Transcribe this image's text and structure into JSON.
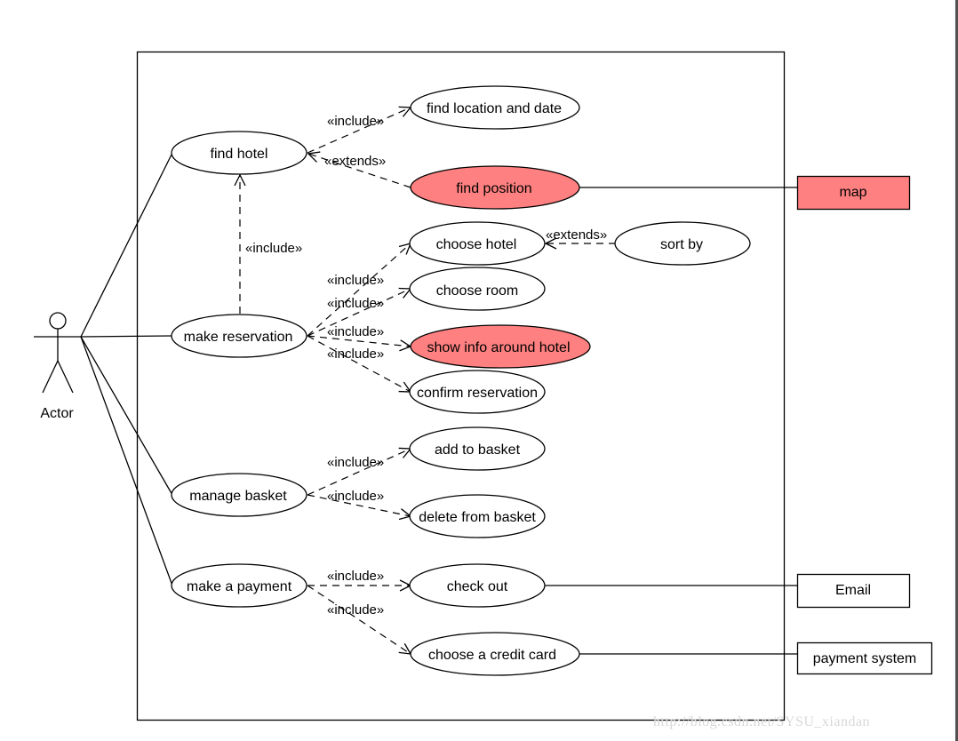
{
  "colors": {
    "highlight_fill": "#FF8080",
    "default_fill": "#FFFFFF",
    "stroke": "#000000"
  },
  "actor": {
    "label": "Actor"
  },
  "use_cases": {
    "find_hotel": "find hotel",
    "find_location_and_date": "find location and date",
    "find_position": "find position",
    "make_reservation": "make reservation",
    "choose_hotel": "choose hotel",
    "sort_by": "sort by",
    "choose_room": "choose room",
    "show_info_around_hotel": "show info around hotel",
    "confirm_reservation": "confirm reservation",
    "manage_basket": "manage basket",
    "add_to_basket": "add to basket",
    "delete_from_basket": "delete from basket",
    "make_a_payment": "make a payment",
    "check_out": "check out",
    "choose_a_credit_card": "choose a credit card"
  },
  "highlighted_use_cases": [
    "find_position",
    "show_info_around_hotel"
  ],
  "external_systems": {
    "map": "map",
    "email": "Email",
    "payment_system": "payment system"
  },
  "relations": [
    {
      "from": "find_hotel",
      "to": "find_location_and_date",
      "type": "include",
      "label": "«include»"
    },
    {
      "from": "find_position",
      "to": "find_hotel",
      "type": "extends",
      "label": "«extends»"
    },
    {
      "from": "make_reservation",
      "to": "find_hotel",
      "type": "include",
      "label": "«include»"
    },
    {
      "from": "make_reservation",
      "to": "choose_hotel",
      "type": "include",
      "label": "«include»"
    },
    {
      "from": "make_reservation",
      "to": "choose_room",
      "type": "include",
      "label": "«include»"
    },
    {
      "from": "make_reservation",
      "to": "show_info_around_hotel",
      "type": "include",
      "label": "«include»"
    },
    {
      "from": "make_reservation",
      "to": "confirm_reservation",
      "type": "include",
      "label": "«include»"
    },
    {
      "from": "sort_by",
      "to": "choose_hotel",
      "type": "extends",
      "label": "«extends»"
    },
    {
      "from": "manage_basket",
      "to": "add_to_basket",
      "type": "include",
      "label": "«include»"
    },
    {
      "from": "manage_basket",
      "to": "delete_from_basket",
      "type": "include",
      "label": "«include»"
    },
    {
      "from": "make_a_payment",
      "to": "check_out",
      "type": "include",
      "label": "«include»"
    },
    {
      "from": "make_a_payment",
      "to": "choose_a_credit_card",
      "type": "include",
      "label": "«include»"
    }
  ],
  "associations": [
    {
      "from": "actor",
      "to": "find_hotel"
    },
    {
      "from": "actor",
      "to": "make_reservation"
    },
    {
      "from": "actor",
      "to": "manage_basket"
    },
    {
      "from": "actor",
      "to": "make_a_payment"
    },
    {
      "from": "find_position",
      "to": "map"
    },
    {
      "from": "check_out",
      "to": "email"
    },
    {
      "from": "choose_a_credit_card",
      "to": "payment_system"
    }
  ],
  "labels": {
    "include": "«include»",
    "extends": "«extends»"
  },
  "watermark": "http://blog.csdn.net/SYSU_xiandan"
}
